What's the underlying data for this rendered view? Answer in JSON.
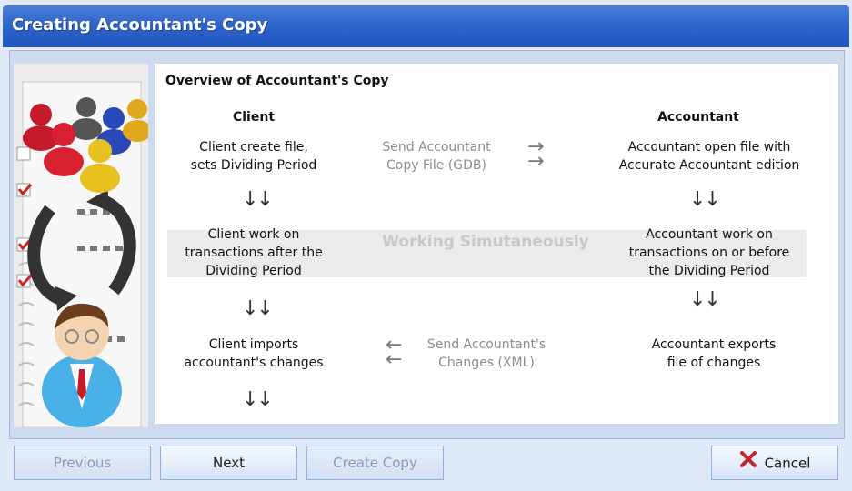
{
  "window": {
    "title": "Creating Accountant's Copy"
  },
  "overview": {
    "heading": "Overview of Accountant's Copy",
    "client_header": "Client",
    "accountant_header": "Accountant",
    "step1_client": "Client create file,\nsets Dividing Period",
    "step1_transfer": "Send Accountant\nCopy File (GDB)",
    "step1_accountant": "Accountant open file with\nAccurate Accountant edition",
    "working_label": "Working Simutaneously",
    "step2_client": "Client work on\ntransactions after the\nDividing Period",
    "step2_accountant": "Accountant work on\ntransactions on or before\nthe Dividing Period",
    "step3_client": "Client imports\naccountant's changes",
    "step3_transfer": "Send Accountant's\nChanges (XML)",
    "step3_accountant": "Accountant exports\nfile of changes",
    "down_arrows": "↓↓",
    "right_arrows": "→\n→",
    "left_arrows": "←\n←"
  },
  "buttons": {
    "previous": "Previous",
    "next": "Next",
    "create_copy": "Create Copy",
    "cancel": "Cancel"
  },
  "icons": {
    "cancel": "x-icon",
    "side": "accountant-illustration"
  },
  "colors": {
    "titlebar": "#2f66cc",
    "cancel_x": "#c0262c"
  }
}
